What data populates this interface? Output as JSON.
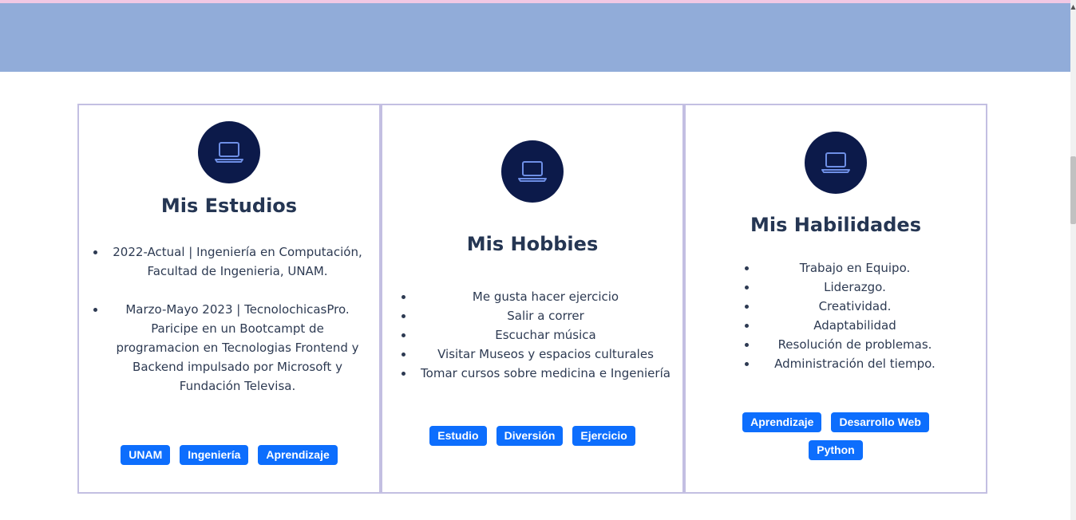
{
  "cards": [
    {
      "title": "Mis Estudios",
      "icon": "laptop-icon",
      "items": [
        "2022-Actual | Ingeniería en Computación, Facultad de Ingenieria, UNAM.",
        "Marzo-Mayo 2023 | TecnolochicasPro. Paricipe en un Bootcampt de programacion en Tecnologias Frontend y Backend impulsado por Microsoft y Fundación Televisa."
      ],
      "tags": [
        "UNAM",
        "Ingeniería",
        "Aprendizaje"
      ]
    },
    {
      "title": "Mis Hobbies",
      "icon": "laptop-icon",
      "items": [
        "Me gusta hacer ejercicio",
        "Salir a correr",
        "Escuchar música",
        "Visitar Museos y espacios culturales",
        "Tomar cursos sobre medicina e Ingeniería"
      ],
      "tags": [
        "Estudio",
        "Diversión",
        "Ejercicio"
      ]
    },
    {
      "title": "Mis Habilidades",
      "icon": "laptop-icon",
      "items": [
        "Trabajo en Equipo.",
        "Liderazgo.",
        "Creatividad.",
        "Adaptabilidad",
        "Resolución de problemas.",
        "Administración del tiempo."
      ],
      "tags": [
        "Aprendizaje",
        "Desarrollo Web",
        "Python"
      ]
    }
  ],
  "colors": {
    "banner": "#91acd9",
    "card_border": "#c3bfe2",
    "icon_bg": "#0c1a4a",
    "icon_stroke": "#6e8fe6",
    "tag_bg": "#0d6efd"
  }
}
